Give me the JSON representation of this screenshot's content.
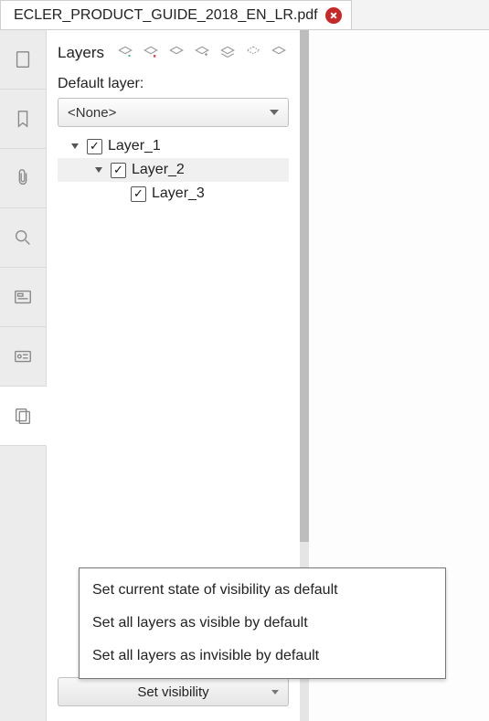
{
  "tab": {
    "title": "ECLER_PRODUCT_GUIDE_2018_EN_LR.pdf"
  },
  "panel": {
    "title": "Layers",
    "defaultLabel": "Default layer:",
    "defaultValue": "<None>",
    "setVisibilityLabel": "Set visibility"
  },
  "layers": [
    {
      "name": "Layer_1"
    },
    {
      "name": "Layer_2"
    },
    {
      "name": "Layer_3"
    }
  ],
  "menu": {
    "items": [
      "Set current state of visibility as default",
      "Set all layers as visible by default",
      "Set all layers as invisible by default"
    ]
  }
}
